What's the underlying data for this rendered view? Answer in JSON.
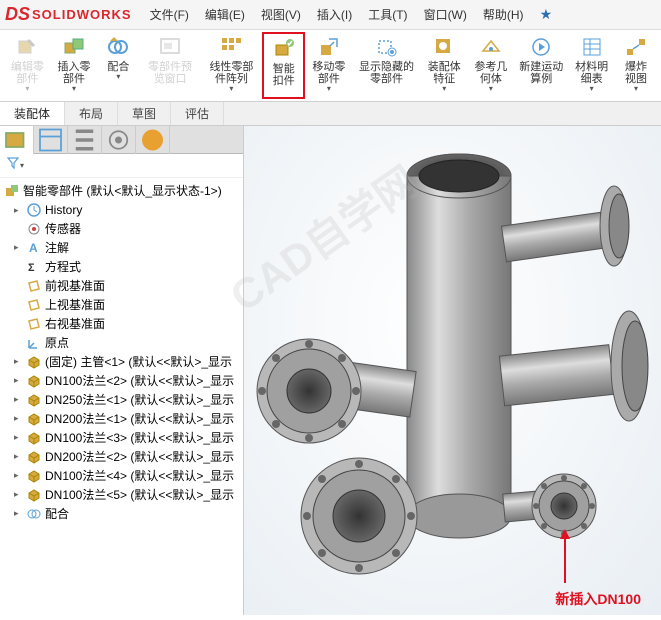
{
  "logo": {
    "ds": "DS",
    "text": "SOLIDWORKS"
  },
  "menu": [
    {
      "label": "文件(F)"
    },
    {
      "label": "编辑(E)"
    },
    {
      "label": "视图(V)"
    },
    {
      "label": "插入(I)"
    },
    {
      "label": "工具(T)"
    },
    {
      "label": "窗口(W)"
    },
    {
      "label": "帮助(H)"
    }
  ],
  "toolbar": [
    {
      "name": "edit-component",
      "label": "编辑零部件",
      "disabled": true
    },
    {
      "name": "insert-component",
      "label": "插入零部件"
    },
    {
      "name": "mate",
      "label": "配合"
    },
    {
      "name": "component-preview",
      "label": "零部件预览窗口",
      "disabled": true
    },
    {
      "name": "linear-pattern",
      "label": "线性零部件阵列"
    },
    {
      "name": "smart-fasteners",
      "label": "智能扣件",
      "highlighted": true
    },
    {
      "name": "move-component",
      "label": "移动零部件"
    },
    {
      "name": "show-hidden",
      "label": "显示隐藏的零部件"
    },
    {
      "name": "assembly-features",
      "label": "装配体特征"
    },
    {
      "name": "reference-geometry",
      "label": "参考几何体"
    },
    {
      "name": "new-motion",
      "label": "新建运动算例"
    },
    {
      "name": "bom",
      "label": "材料明细表"
    },
    {
      "name": "exploded-view",
      "label": "爆炸视图"
    }
  ],
  "tabs": [
    {
      "label": "装配体",
      "active": true
    },
    {
      "label": "布局"
    },
    {
      "label": "草图"
    },
    {
      "label": "评估"
    }
  ],
  "tree_root": {
    "label": "智能零部件  (默认<默认_显示状态-1>)"
  },
  "tree": [
    {
      "icon": "history",
      "label": "History",
      "toggle": "▸"
    },
    {
      "icon": "sensor",
      "label": "传感器"
    },
    {
      "icon": "annotation",
      "label": "注解",
      "toggle": "▸"
    },
    {
      "icon": "equation",
      "label": "方程式"
    },
    {
      "icon": "plane",
      "label": "前视基准面"
    },
    {
      "icon": "plane",
      "label": "上视基准面"
    },
    {
      "icon": "plane",
      "label": "右视基准面"
    },
    {
      "icon": "origin",
      "label": "原点"
    },
    {
      "icon": "part",
      "label": "(固定) 主管<1> (默认<<默认>_显示",
      "toggle": "▸"
    },
    {
      "icon": "part",
      "label": "DN100法兰<2> (默认<<默认>_显示",
      "toggle": "▸"
    },
    {
      "icon": "part",
      "label": "DN250法兰<1> (默认<<默认>_显示",
      "toggle": "▸"
    },
    {
      "icon": "part",
      "label": "DN200法兰<1> (默认<<默认>_显示",
      "toggle": "▸"
    },
    {
      "icon": "part",
      "label": "DN100法兰<3> (默认<<默认>_显示",
      "toggle": "▸"
    },
    {
      "icon": "part",
      "label": "DN200法兰<2> (默认<<默认>_显示",
      "toggle": "▸"
    },
    {
      "icon": "part",
      "label": "DN100法兰<4> (默认<<默认>_显示",
      "toggle": "▸"
    },
    {
      "icon": "part",
      "label": "DN100法兰<5> (默认<<默认>_显示",
      "toggle": "▸"
    },
    {
      "icon": "mate",
      "label": "配合",
      "toggle": "▸"
    }
  ],
  "watermark": "CAD自学网",
  "annotation": "新插入DN100",
  "colors": {
    "brand": "#d9272e",
    "highlight": "#e01020",
    "part": "#d6a942"
  }
}
